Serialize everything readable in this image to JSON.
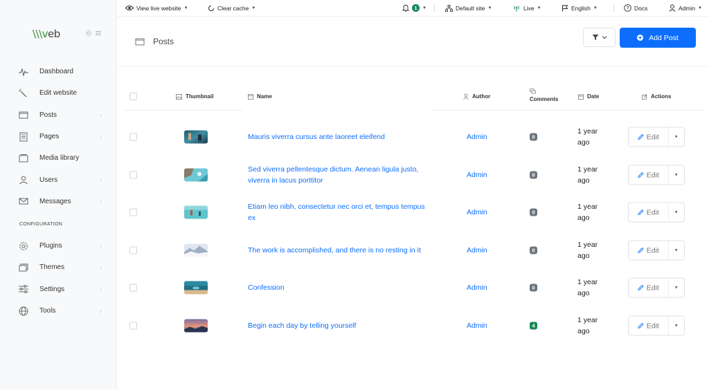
{
  "app": {
    "logo_text": "eb"
  },
  "topbar": {
    "view_live": "View live website",
    "clear_cache": "Clear cache",
    "notifications_count": "1",
    "site": "Default site",
    "status": "Live",
    "language": "English",
    "docs": "Docs",
    "user": "Admin"
  },
  "sidebar": {
    "items": [
      {
        "label": "Dashboard",
        "icon": "pulse-icon"
      },
      {
        "label": "Edit website",
        "icon": "magic-wand-icon"
      },
      {
        "label": "Posts",
        "icon": "folder-icon",
        "submenu": true
      },
      {
        "label": "Pages",
        "icon": "page-icon",
        "submenu": true
      },
      {
        "label": "Media library",
        "icon": "media-icon"
      },
      {
        "label": "Users",
        "icon": "user-icon",
        "submenu": true
      },
      {
        "label": "Messages",
        "icon": "envelope-icon",
        "submenu": true
      }
    ],
    "section_label": "CONFIGURATION",
    "config_items": [
      {
        "label": "Plugins",
        "icon": "gear-icon",
        "submenu": true
      },
      {
        "label": "Themes",
        "icon": "layers-icon",
        "submenu": true
      },
      {
        "label": "Settings",
        "icon": "sliders-icon",
        "submenu": true
      },
      {
        "label": "Tools",
        "icon": "globe-icon",
        "submenu": true
      }
    ]
  },
  "page": {
    "title": "Posts",
    "add_label": "Add Post"
  },
  "table": {
    "headers": {
      "thumbnail": "Thumbnail",
      "name": "Name",
      "author": "Author",
      "comments": "Comments",
      "date": "Date",
      "actions": "Actions"
    },
    "edit_label": "Edit",
    "rows": [
      {
        "title": "Mauris viverra cursus ante laoreet eleifend",
        "author": "Admin",
        "comments": "0",
        "date": "1 year ago"
      },
      {
        "title": "Sed viverra pellentesque dictum. Aenean ligula justo, viverra in lacus porttitor",
        "author": "Admin",
        "comments": "0",
        "date": "1 year ago"
      },
      {
        "title": "Etiam leo nibh, consectetur nec orci et, tempus tempus ex",
        "author": "Admin",
        "comments": "0",
        "date": "1 year ago"
      },
      {
        "title": "The work is accomplished, and there is no resting in it",
        "author": "Admin",
        "comments": "0",
        "date": "1 year ago"
      },
      {
        "title": "Confession",
        "author": "Admin",
        "comments": "0",
        "date": "1 year ago"
      },
      {
        "title": "Begin each day by telling yourself",
        "author": "Admin",
        "comments": "4",
        "date": "1 year ago"
      }
    ]
  },
  "colors": {
    "primary": "#0d6efd",
    "success": "#198754",
    "muted_badge": "#6c757d"
  }
}
